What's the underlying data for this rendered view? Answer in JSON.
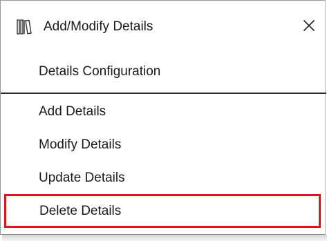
{
  "window": {
    "title": "Add/Modify Details",
    "app_icon": "library-books-icon",
    "close_icon": "close-icon",
    "close_glyph": "✕"
  },
  "section": {
    "header": "Details Configuration"
  },
  "menu": {
    "items": [
      {
        "label": "Add Details",
        "highlighted": false
      },
      {
        "label": "Modify Details",
        "highlighted": false
      },
      {
        "label": "Update Details",
        "highlighted": false
      },
      {
        "label": "Delete Details",
        "highlighted": true
      }
    ]
  },
  "colors": {
    "highlight_border": "#e0121a",
    "divider": "#2b2b2b"
  }
}
